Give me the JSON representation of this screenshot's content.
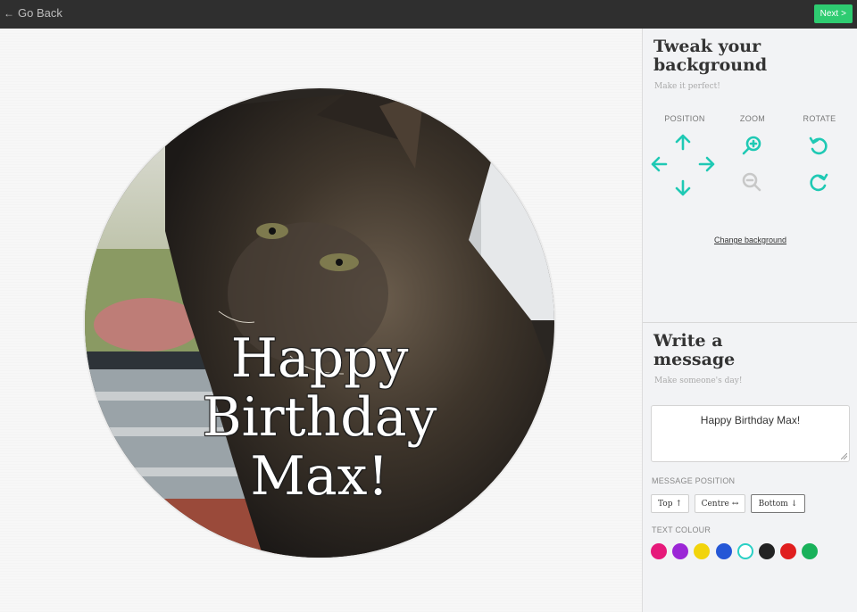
{
  "topbar": {
    "back_label": "Go Back",
    "next_label": "Next",
    "next_chevron": ">"
  },
  "card": {
    "message": "Happy\nBirthday\nMax!"
  },
  "tweak": {
    "title": "Tweak your background",
    "subtitle": "Make it perfect!",
    "position_label": "POSITION",
    "zoom_label": "ZOOM",
    "rotate_label": "ROTATE",
    "change_background": "Change background",
    "accent_color": "#1fc9b4"
  },
  "write": {
    "title": "Write a message",
    "subtitle": "Make someone's day!",
    "message_value": "Happy Birthday Max!",
    "position_heading": "MESSAGE POSITION",
    "positions": [
      {
        "label": "Top",
        "icon": "arrow-up-icon",
        "glyph": "↑"
      },
      {
        "label": "Centre",
        "icon": "arrow-left-right-icon",
        "glyph": "↔"
      },
      {
        "label": "Bottom",
        "icon": "arrow-down-icon",
        "glyph": "↓",
        "selected": true
      }
    ],
    "colour_heading": "TEXT COLOUR",
    "colours": [
      "#e6197a",
      "#9b26d6",
      "#f2d40b",
      "#2557d6",
      "#ffffff",
      "#222222",
      "#e01e1e",
      "#19b15a"
    ],
    "selected_colour": "#ffffff"
  }
}
